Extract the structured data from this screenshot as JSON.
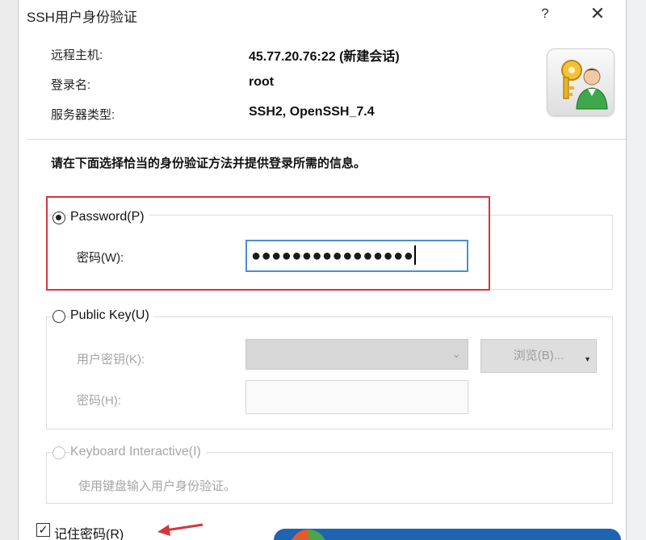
{
  "window": {
    "title": "SSH用户身份验证"
  },
  "titlebar": {
    "help_glyph": "?",
    "close_glyph": "✕"
  },
  "session_info": {
    "host_label": "远程主机:",
    "host_value": "45.77.20.76:22 (新建会话)",
    "login_label": "登录名:",
    "login_value": "root",
    "server_type_label": "服务器类型:",
    "server_type_value": "SSH2, OpenSSH_7.4"
  },
  "instruction": "请在下面选择恰当的身份验证方法并提供登录所需的信息。",
  "password_method": {
    "label": "Password(P)",
    "selected": true,
    "field_label": "密码(W):",
    "masked_value": "●●●●●●●●●●●●●●●●"
  },
  "public_key_method": {
    "label": "Public Key(U)",
    "selected": false,
    "user_key_label": "用户密钥(K):",
    "passphrase_label": "密码(H):",
    "browse_label": "浏览(B)..."
  },
  "keyboard_method": {
    "label": "Keyboard Interactive(I)",
    "description": "使用键盘输入用户身份验证。"
  },
  "remember": {
    "label": "记住密码(R)",
    "checked": true
  },
  "icons": {
    "keys_user": "keys-user-icon",
    "dropdown": "chevron-down-icon",
    "annotation": "red-arrow-icon"
  },
  "colors": {
    "highlight": "#d2373c",
    "focus_border": "#4b8fd0",
    "disabled_text": "#a6a6a6",
    "banner": "#1f64b3"
  }
}
